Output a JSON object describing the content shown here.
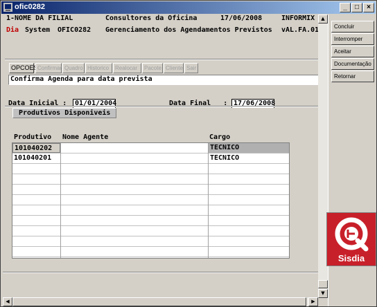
{
  "window": {
    "title": "ofic0282",
    "minimize": "_",
    "maximize": "□",
    "close": "×"
  },
  "header": {
    "filial": "1-NOME DA FILIAL",
    "company": "Consultores da Oficina",
    "date": "17/06/2008",
    "db": "INFORMIX",
    "brand_red": "Dia",
    "brand_rest": " System",
    "program": "OFIC0282",
    "subtitle": "Gerenciamento dos Agendamentos Previstos",
    "version": "vAL.FA.01"
  },
  "options": {
    "label": "OPCOES",
    "items": [
      "Confirmar",
      "Quadro",
      "Historico",
      "Realocar",
      "Pacote",
      "Cliente",
      "Sair"
    ]
  },
  "message": "Confirma Agenda para data prevista",
  "filters": {
    "start_label": "Data Inicial :",
    "start_value": "01/01/2004",
    "end_label": "Data Final   :",
    "end_value": "17/06/2008"
  },
  "panel": {
    "title": "Produtivos Disponiveis"
  },
  "table": {
    "columns": [
      "Produtivo",
      "Nome Agente",
      "Cargo"
    ],
    "rows": [
      {
        "produtivo": "101040202",
        "nome": "",
        "cargo": "TECNICO"
      },
      {
        "produtivo": "101040201",
        "nome": "",
        "cargo": "TECNICO"
      }
    ]
  },
  "sidebar": {
    "buttons": [
      "Concluir",
      "Interromper",
      "Aceitar",
      "Documentação",
      "Retornar"
    ]
  },
  "logo": {
    "text": "Sisdia"
  },
  "colors": {
    "titlebar": "#0a246a",
    "brand_red": "#c00000",
    "logo_bg": "#c8202a"
  }
}
